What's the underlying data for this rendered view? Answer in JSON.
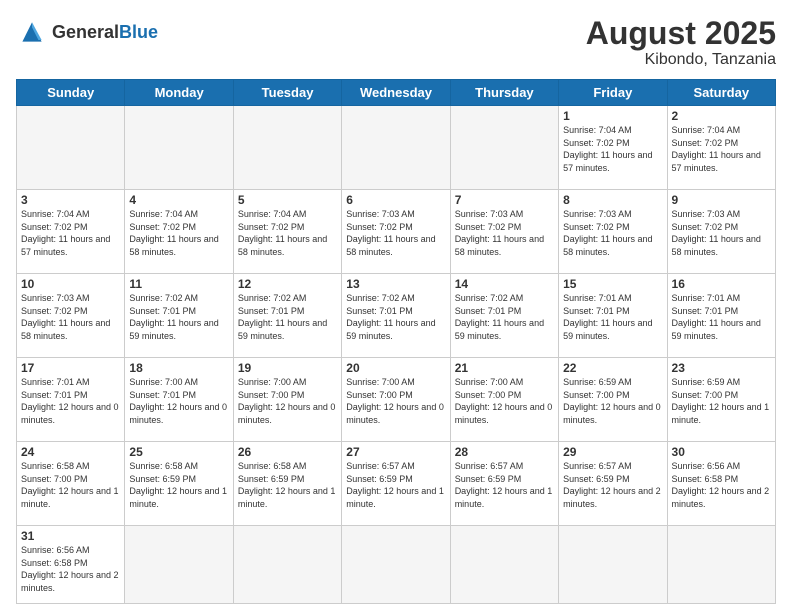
{
  "header": {
    "logo_general": "General",
    "logo_blue": "Blue",
    "month_year": "August 2025",
    "location": "Kibondo, Tanzania"
  },
  "weekdays": [
    "Sunday",
    "Monday",
    "Tuesday",
    "Wednesday",
    "Thursday",
    "Friday",
    "Saturday"
  ],
  "weeks": [
    [
      {
        "day": "",
        "info": "",
        "empty": true
      },
      {
        "day": "",
        "info": "",
        "empty": true
      },
      {
        "day": "",
        "info": "",
        "empty": true
      },
      {
        "day": "",
        "info": "",
        "empty": true
      },
      {
        "day": "",
        "info": "",
        "empty": true
      },
      {
        "day": "1",
        "info": "Sunrise: 7:04 AM\nSunset: 7:02 PM\nDaylight: 11 hours\nand 57 minutes."
      },
      {
        "day": "2",
        "info": "Sunrise: 7:04 AM\nSunset: 7:02 PM\nDaylight: 11 hours\nand 57 minutes."
      }
    ],
    [
      {
        "day": "3",
        "info": "Sunrise: 7:04 AM\nSunset: 7:02 PM\nDaylight: 11 hours\nand 57 minutes."
      },
      {
        "day": "4",
        "info": "Sunrise: 7:04 AM\nSunset: 7:02 PM\nDaylight: 11 hours\nand 58 minutes."
      },
      {
        "day": "5",
        "info": "Sunrise: 7:04 AM\nSunset: 7:02 PM\nDaylight: 11 hours\nand 58 minutes."
      },
      {
        "day": "6",
        "info": "Sunrise: 7:03 AM\nSunset: 7:02 PM\nDaylight: 11 hours\nand 58 minutes."
      },
      {
        "day": "7",
        "info": "Sunrise: 7:03 AM\nSunset: 7:02 PM\nDaylight: 11 hours\nand 58 minutes."
      },
      {
        "day": "8",
        "info": "Sunrise: 7:03 AM\nSunset: 7:02 PM\nDaylight: 11 hours\nand 58 minutes."
      },
      {
        "day": "9",
        "info": "Sunrise: 7:03 AM\nSunset: 7:02 PM\nDaylight: 11 hours\nand 58 minutes."
      }
    ],
    [
      {
        "day": "10",
        "info": "Sunrise: 7:03 AM\nSunset: 7:02 PM\nDaylight: 11 hours\nand 58 minutes."
      },
      {
        "day": "11",
        "info": "Sunrise: 7:02 AM\nSunset: 7:01 PM\nDaylight: 11 hours\nand 59 minutes."
      },
      {
        "day": "12",
        "info": "Sunrise: 7:02 AM\nSunset: 7:01 PM\nDaylight: 11 hours\nand 59 minutes."
      },
      {
        "day": "13",
        "info": "Sunrise: 7:02 AM\nSunset: 7:01 PM\nDaylight: 11 hours\nand 59 minutes."
      },
      {
        "day": "14",
        "info": "Sunrise: 7:02 AM\nSunset: 7:01 PM\nDaylight: 11 hours\nand 59 minutes."
      },
      {
        "day": "15",
        "info": "Sunrise: 7:01 AM\nSunset: 7:01 PM\nDaylight: 11 hours\nand 59 minutes."
      },
      {
        "day": "16",
        "info": "Sunrise: 7:01 AM\nSunset: 7:01 PM\nDaylight: 11 hours\nand 59 minutes."
      }
    ],
    [
      {
        "day": "17",
        "info": "Sunrise: 7:01 AM\nSunset: 7:01 PM\nDaylight: 12 hours\nand 0 minutes."
      },
      {
        "day": "18",
        "info": "Sunrise: 7:00 AM\nSunset: 7:01 PM\nDaylight: 12 hours\nand 0 minutes."
      },
      {
        "day": "19",
        "info": "Sunrise: 7:00 AM\nSunset: 7:00 PM\nDaylight: 12 hours\nand 0 minutes."
      },
      {
        "day": "20",
        "info": "Sunrise: 7:00 AM\nSunset: 7:00 PM\nDaylight: 12 hours\nand 0 minutes."
      },
      {
        "day": "21",
        "info": "Sunrise: 7:00 AM\nSunset: 7:00 PM\nDaylight: 12 hours\nand 0 minutes."
      },
      {
        "day": "22",
        "info": "Sunrise: 6:59 AM\nSunset: 7:00 PM\nDaylight: 12 hours\nand 0 minutes."
      },
      {
        "day": "23",
        "info": "Sunrise: 6:59 AM\nSunset: 7:00 PM\nDaylight: 12 hours\nand 1 minute."
      }
    ],
    [
      {
        "day": "24",
        "info": "Sunrise: 6:58 AM\nSunset: 7:00 PM\nDaylight: 12 hours\nand 1 minute."
      },
      {
        "day": "25",
        "info": "Sunrise: 6:58 AM\nSunset: 6:59 PM\nDaylight: 12 hours\nand 1 minute."
      },
      {
        "day": "26",
        "info": "Sunrise: 6:58 AM\nSunset: 6:59 PM\nDaylight: 12 hours\nand 1 minute."
      },
      {
        "day": "27",
        "info": "Sunrise: 6:57 AM\nSunset: 6:59 PM\nDaylight: 12 hours\nand 1 minute."
      },
      {
        "day": "28",
        "info": "Sunrise: 6:57 AM\nSunset: 6:59 PM\nDaylight: 12 hours\nand 1 minute."
      },
      {
        "day": "29",
        "info": "Sunrise: 6:57 AM\nSunset: 6:59 PM\nDaylight: 12 hours\nand 2 minutes."
      },
      {
        "day": "30",
        "info": "Sunrise: 6:56 AM\nSunset: 6:58 PM\nDaylight: 12 hours\nand 2 minutes."
      }
    ],
    [
      {
        "day": "31",
        "info": "Sunrise: 6:56 AM\nSunset: 6:58 PM\nDaylight: 12 hours\nand 2 minutes.",
        "last": true
      },
      {
        "day": "",
        "info": "",
        "empty": true,
        "last": true
      },
      {
        "day": "",
        "info": "",
        "empty": true,
        "last": true
      },
      {
        "day": "",
        "info": "",
        "empty": true,
        "last": true
      },
      {
        "day": "",
        "info": "",
        "empty": true,
        "last": true
      },
      {
        "day": "",
        "info": "",
        "empty": true,
        "last": true
      },
      {
        "day": "",
        "info": "",
        "empty": true,
        "last": true
      }
    ]
  ]
}
